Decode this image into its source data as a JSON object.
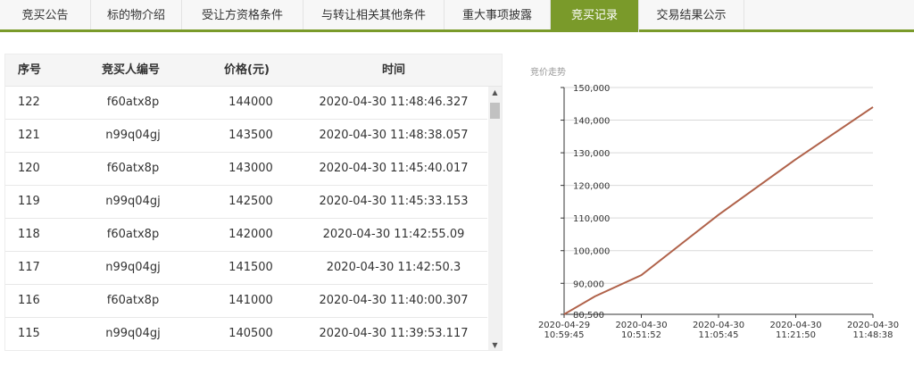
{
  "tabs": [
    {
      "label": "竞买公告",
      "active": false
    },
    {
      "label": "标的物介绍",
      "active": false
    },
    {
      "label": "受让方资格条件",
      "active": false
    },
    {
      "label": "与转让相关其他条件",
      "active": false
    },
    {
      "label": "重大事项披露",
      "active": false
    },
    {
      "label": "竞买记录",
      "active": true
    },
    {
      "label": "交易结果公示",
      "active": false
    }
  ],
  "table": {
    "headers": {
      "seq": "序号",
      "bidder": "竞买人编号",
      "price": "价格(元)",
      "time": "时间"
    },
    "rows": [
      {
        "seq": "122",
        "bidder": "f60atx8p",
        "price": "144000",
        "time": "2020-04-30 11:48:46.327"
      },
      {
        "seq": "121",
        "bidder": "n99q04gj",
        "price": "143500",
        "time": "2020-04-30 11:48:38.057"
      },
      {
        "seq": "120",
        "bidder": "f60atx8p",
        "price": "143000",
        "time": "2020-04-30 11:45:40.017"
      },
      {
        "seq": "119",
        "bidder": "n99q04gj",
        "price": "142500",
        "time": "2020-04-30 11:45:33.153"
      },
      {
        "seq": "118",
        "bidder": "f60atx8p",
        "price": "142000",
        "time": "2020-04-30 11:42:55.09"
      },
      {
        "seq": "117",
        "bidder": "n99q04gj",
        "price": "141500",
        "time": "2020-04-30 11:42:50.3"
      },
      {
        "seq": "116",
        "bidder": "f60atx8p",
        "price": "141000",
        "time": "2020-04-30 11:40:00.307"
      },
      {
        "seq": "115",
        "bidder": "n99q04gj",
        "price": "140500",
        "time": "2020-04-30 11:39:53.117"
      }
    ]
  },
  "chart_data": {
    "type": "line",
    "title": "竞价走势",
    "xlabel": "",
    "ylabel": "",
    "ylim": [
      80500,
      150000
    ],
    "yticks": [
      80500,
      90000,
      100000,
      110000,
      120000,
      130000,
      140000,
      150000
    ],
    "ytick_labels": [
      "80,500",
      "90,000",
      "100,000",
      "110,000",
      "120,000",
      "130,000",
      "140,000",
      "150,000"
    ],
    "xticks": [
      {
        "date": "2020-04-29",
        "time": "10:59:45"
      },
      {
        "date": "2020-04-30",
        "time": "10:51:52"
      },
      {
        "date": "2020-04-30",
        "time": "11:05:45"
      },
      {
        "date": "2020-04-30",
        "time": "11:21:50"
      },
      {
        "date": "2020-04-30",
        "time": "11:48:38"
      }
    ],
    "x": [
      0,
      0.1,
      0.25,
      0.5,
      0.75,
      1.0
    ],
    "values": [
      80500,
      86000,
      92500,
      111000,
      128000,
      144000
    ],
    "grid": true,
    "line_color": "#b0624a"
  }
}
